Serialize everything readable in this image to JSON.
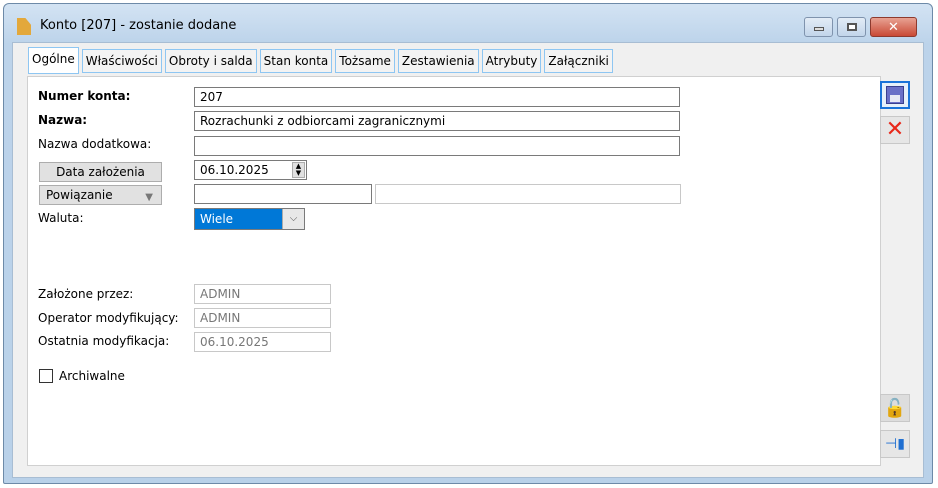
{
  "window": {
    "title": "Konto [207] - zostanie dodane"
  },
  "tabs": [
    "Ogólne",
    "Właściwości",
    "Obroty i salda",
    "Stan konta",
    "Tożsame",
    "Zestawienia",
    "Atrybuty",
    "Załączniki"
  ],
  "form": {
    "numer_label": "Numer konta:",
    "numer_value": "207",
    "nazwa_label": "Nazwa:",
    "nazwa_value": "Rozrachunki z odbiorcami zagranicznymi",
    "nazwa_dod_label": "Nazwa dodatkowa:",
    "nazwa_dod_value": "",
    "data_button": "Data założenia",
    "data_value": "06.10.2025",
    "powiazanie_button": "Powiązanie",
    "powiazanie_value": "",
    "powiazanie_value2": "",
    "waluta_label": "Waluta:",
    "waluta_value": "Wiele",
    "zalozone_label": "Założone przez:",
    "zalozone_value": "ADMIN",
    "operator_label": "Operator modyfikujący:",
    "operator_value": "ADMIN",
    "ostatnia_label": "Ostatnia modyfikacja:",
    "ostatnia_value": "06.10.2025",
    "archiwalne_label": "Archiwalne",
    "archiwalne_checked": false
  }
}
